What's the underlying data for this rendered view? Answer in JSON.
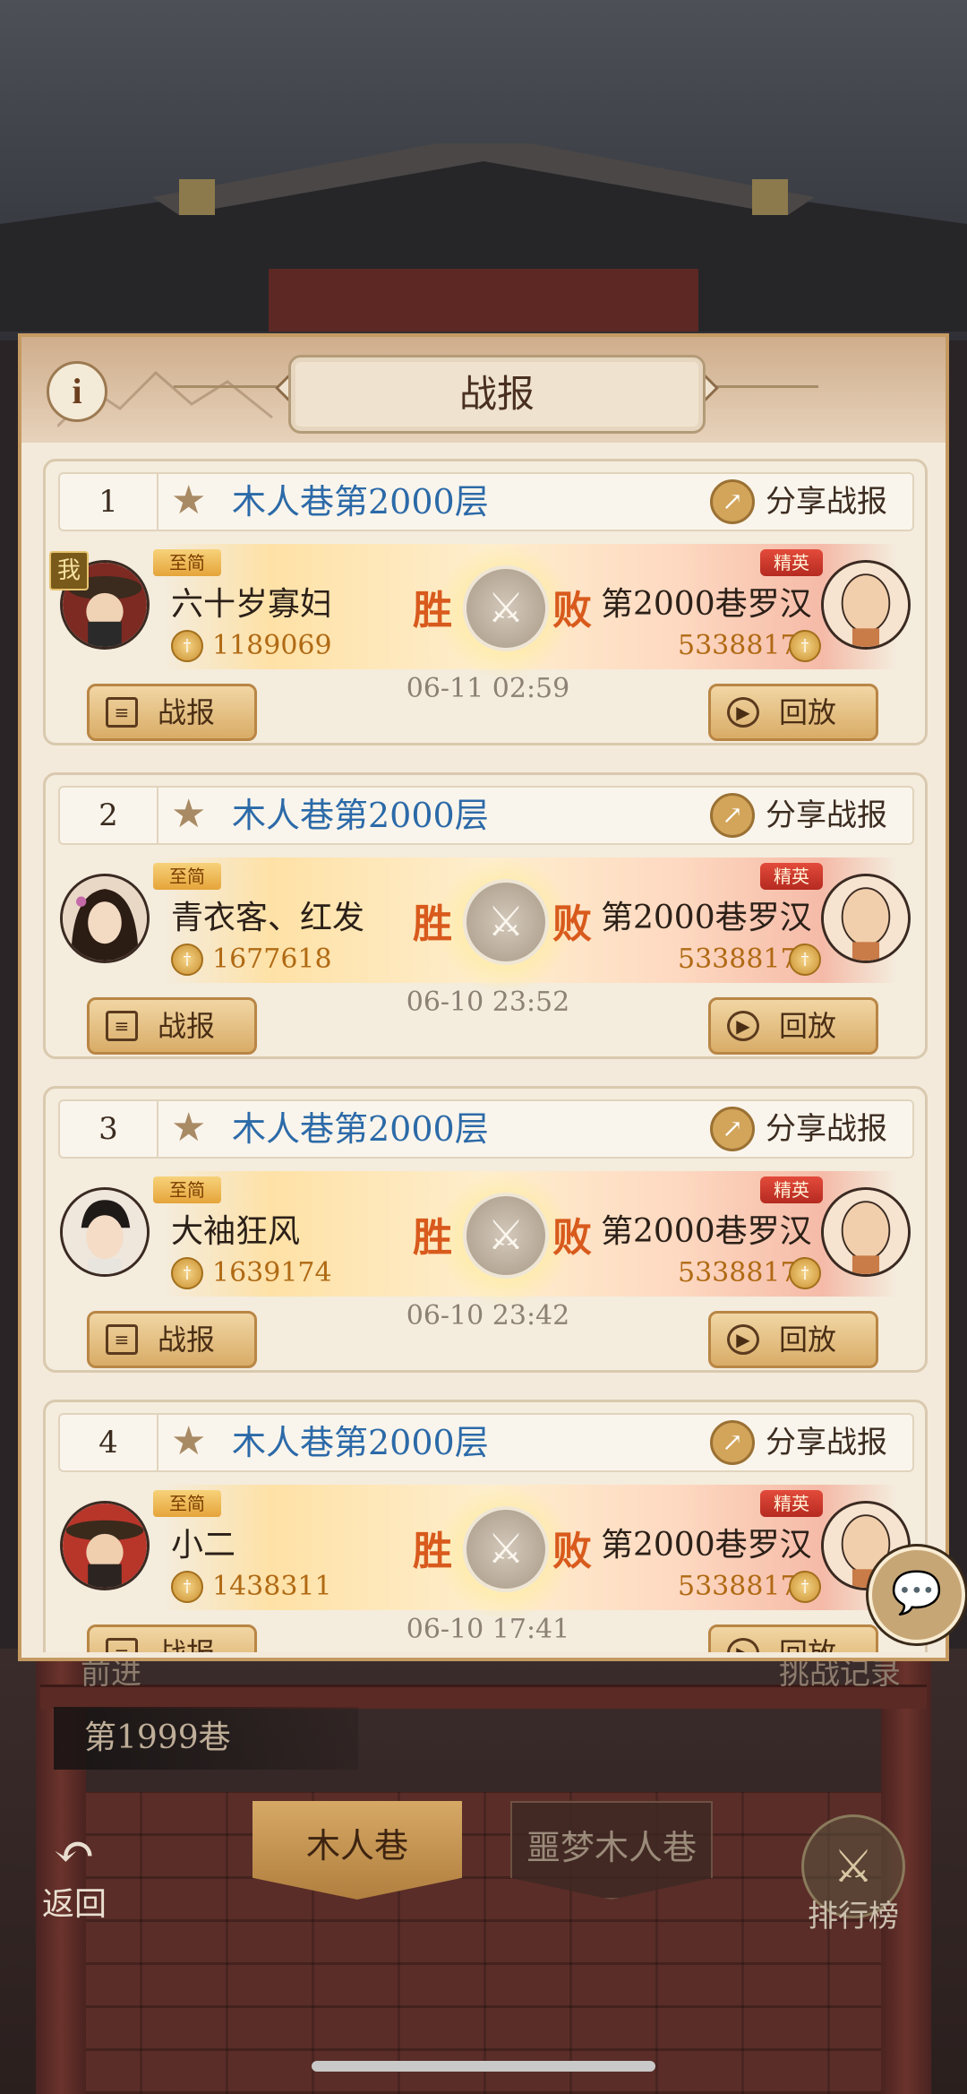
{
  "panel": {
    "title": "战报",
    "info_icon": "i"
  },
  "records": [
    {
      "index": "1",
      "floor_title": "木人巷第2000层",
      "share_label": "分享战报",
      "is_me": true,
      "me_badge": "我",
      "left": {
        "rank_tag": "至简",
        "name": "六十岁寡妇",
        "power": "1189069"
      },
      "right": {
        "rank_tag": "精英",
        "name": "第2000巷罗汉",
        "power": "5338817"
      },
      "win_label": "胜",
      "lose_label": "败",
      "time": "06-11 02:59",
      "report_label": "战报",
      "replay_label": "回放"
    },
    {
      "index": "2",
      "floor_title": "木人巷第2000层",
      "share_label": "分享战报",
      "is_me": false,
      "left": {
        "rank_tag": "至简",
        "name": "青衣客、红发",
        "power": "1677618"
      },
      "right": {
        "rank_tag": "精英",
        "name": "第2000巷罗汉",
        "power": "5338817"
      },
      "win_label": "胜",
      "lose_label": "败",
      "time": "06-10 23:52",
      "report_label": "战报",
      "replay_label": "回放"
    },
    {
      "index": "3",
      "floor_title": "木人巷第2000层",
      "share_label": "分享战报",
      "is_me": false,
      "left": {
        "rank_tag": "至简",
        "name": "大袖狂风",
        "power": "1639174"
      },
      "right": {
        "rank_tag": "精英",
        "name": "第2000巷罗汉",
        "power": "5338817"
      },
      "win_label": "胜",
      "lose_label": "败",
      "time": "06-10 23:42",
      "report_label": "战报",
      "replay_label": "回放"
    },
    {
      "index": "4",
      "floor_title": "木人巷第2000层",
      "share_label": "分享战报",
      "is_me": false,
      "left": {
        "rank_tag": "至简",
        "name": "小二",
        "power": "1438311"
      },
      "right": {
        "rank_tag": "精英",
        "name": "第2000巷罗汉",
        "power": "5338817"
      },
      "win_label": "胜",
      "lose_label": "败",
      "time": "06-10 17:41",
      "report_label": "战报",
      "replay_label": "回放"
    }
  ],
  "background": {
    "left_hint": "前进",
    "right_hint": "挑战记录",
    "floor_label": "第1999巷",
    "tab_active": "木人巷",
    "tab_inactive": "噩梦木人巷",
    "back_label": "返回",
    "rank_label": "排行榜"
  },
  "colors": {
    "panel_bg": "#f3eadb",
    "floor_title": "#2c6aa8",
    "win_lose": "#d85a1c",
    "power": "#b06a14",
    "elite_tag": "#c9342a",
    "rank_tag": "#e5a43a"
  },
  "icons": [
    "info-icon",
    "star-icon",
    "share-icon",
    "crossed-swords-icon",
    "coin-icon",
    "report-list-icon",
    "play-icon",
    "chat-icon",
    "back-arrow-icon",
    "ranking-icon"
  ]
}
